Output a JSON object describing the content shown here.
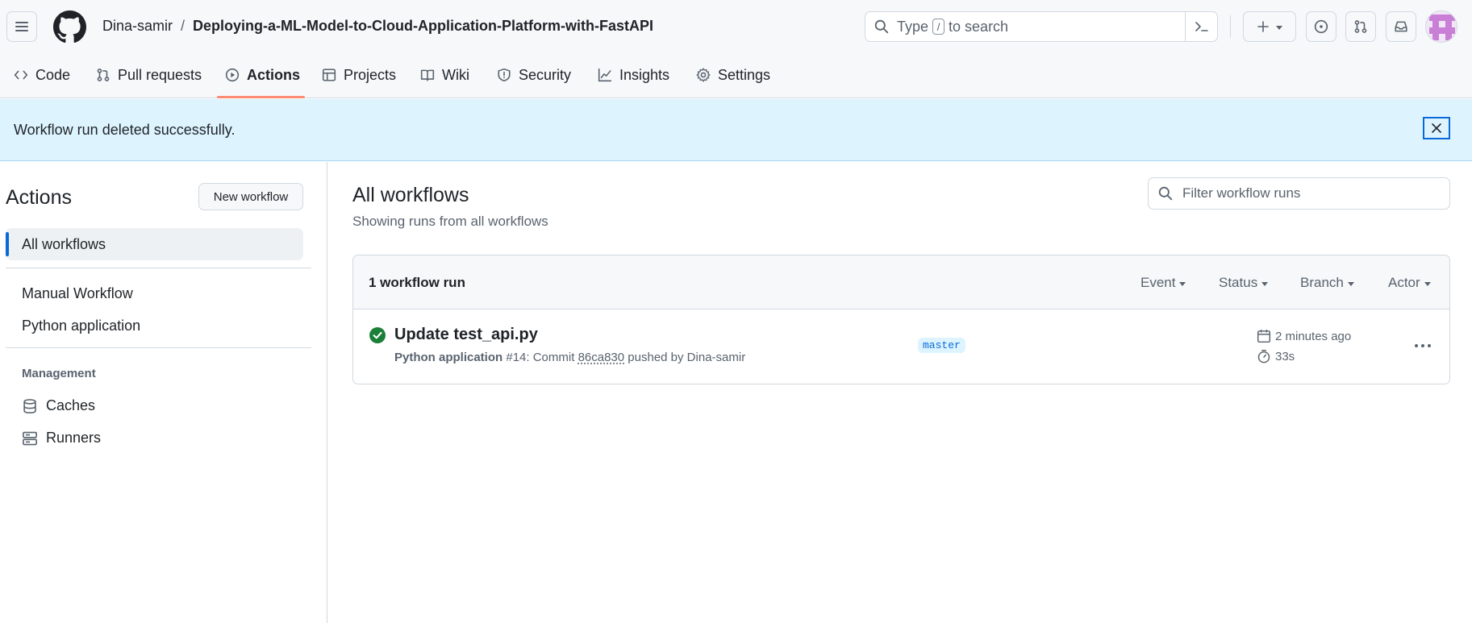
{
  "header": {
    "owner": "Dina-samir",
    "separator": "/",
    "repo": "Deploying-a-ML-Model-to-Cloud-Application-Platform-with-FastAPI",
    "search": {
      "type_text": "Type",
      "key": "/",
      "suffix": "to search"
    }
  },
  "nav": {
    "tabs": [
      {
        "label": "Code",
        "icon": "code-icon"
      },
      {
        "label": "Pull requests",
        "icon": "git-pull-request-icon"
      },
      {
        "label": "Actions",
        "icon": "play-icon",
        "active": true
      },
      {
        "label": "Projects",
        "icon": "table-icon"
      },
      {
        "label": "Wiki",
        "icon": "book-icon"
      },
      {
        "label": "Security",
        "icon": "shield-icon"
      },
      {
        "label": "Insights",
        "icon": "graph-icon"
      },
      {
        "label": "Settings",
        "icon": "gear-icon"
      }
    ]
  },
  "flash": {
    "message": "Workflow run deleted successfully."
  },
  "sidebar": {
    "title": "Actions",
    "new_workflow": "New workflow",
    "all_workflows": "All workflows",
    "workflows": [
      "Manual Workflow",
      "Python application"
    ],
    "management_heading": "Management",
    "management": [
      {
        "label": "Caches",
        "icon": "database-icon"
      },
      {
        "label": "Runners",
        "icon": "server-icon"
      }
    ]
  },
  "main": {
    "title": "All workflows",
    "subtitle": "Showing runs from all workflows",
    "filter_placeholder": "Filter workflow runs",
    "count": "1 workflow run",
    "filters": [
      "Event",
      "Status",
      "Branch",
      "Actor"
    ],
    "runs": [
      {
        "title": "Update test_api.py",
        "workflow": "Python application",
        "number": "#14",
        "commit_prefix": ": Commit",
        "sha": "86ca830",
        "pushed_by": "pushed by Dina-samir",
        "branch": "master",
        "when": "2 minutes ago",
        "duration": "33s",
        "status": "success"
      }
    ]
  },
  "colors": {
    "accent": "#0969da",
    "success": "#1a7f37",
    "tab_underline": "#fd8c73",
    "flash_bg": "#ddf4ff"
  }
}
